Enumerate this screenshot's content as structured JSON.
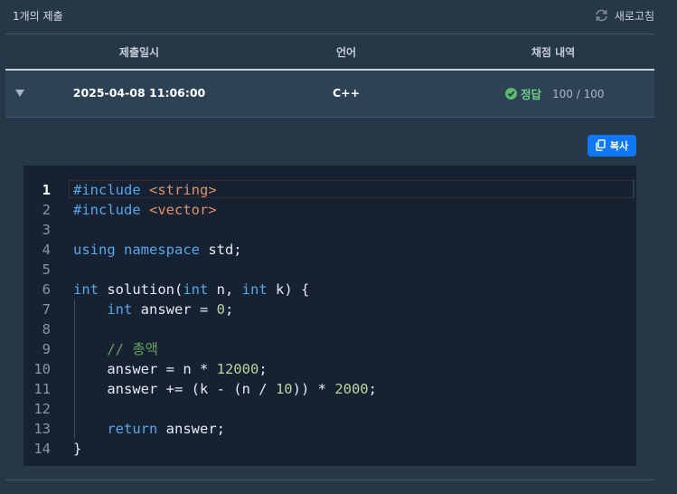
{
  "header": {
    "submission_count": "1개의 제출",
    "refresh_label": "새로고침"
  },
  "table": {
    "columns": [
      "제출일시",
      "언어",
      "채점 내역"
    ],
    "row": {
      "datetime": "2025-04-08 11:06:00",
      "language": "C++",
      "status": "정답",
      "score": "100 / 100"
    }
  },
  "copy_button": {
    "label": "복사"
  },
  "colors": {
    "background": "#263747",
    "row_background": "#2e4256",
    "editor_background": "#162131",
    "accent_blue": "#0f78f2",
    "success_green": "#6fcf83",
    "keyword": "#5aa6e8",
    "string": "#e0906a",
    "number": "#b9d6a0",
    "comment": "#6aa35f"
  },
  "editor": {
    "active_line": 1,
    "lines": [
      {
        "n": "1",
        "tokens": [
          {
            "t": "#include ",
            "c": "kw"
          },
          {
            "t": "<string>",
            "c": "str"
          }
        ]
      },
      {
        "n": "2",
        "tokens": [
          {
            "t": "#include ",
            "c": "kw"
          },
          {
            "t": "<vector>",
            "c": "str"
          }
        ]
      },
      {
        "n": "3",
        "tokens": []
      },
      {
        "n": "4",
        "tokens": [
          {
            "t": "using namespace ",
            "c": "kw"
          },
          {
            "t": "std;",
            "c": ""
          }
        ]
      },
      {
        "n": "5",
        "tokens": []
      },
      {
        "n": "6",
        "tokens": [
          {
            "t": "int",
            "c": "kw"
          },
          {
            "t": " solution(",
            "c": ""
          },
          {
            "t": "int",
            "c": "kw"
          },
          {
            "t": " n, ",
            "c": ""
          },
          {
            "t": "int",
            "c": "kw"
          },
          {
            "t": " k) {",
            "c": ""
          }
        ]
      },
      {
        "n": "7",
        "tokens": [
          {
            "t": "    ",
            "c": ""
          },
          {
            "t": "int",
            "c": "kw"
          },
          {
            "t": " answer = ",
            "c": ""
          },
          {
            "t": "0",
            "c": "num"
          },
          {
            "t": ";",
            "c": ""
          }
        ]
      },
      {
        "n": "8",
        "tokens": []
      },
      {
        "n": "9",
        "tokens": [
          {
            "t": "    ",
            "c": ""
          },
          {
            "t": "// 총액",
            "c": "com"
          }
        ]
      },
      {
        "n": "10",
        "tokens": [
          {
            "t": "    answer = n * ",
            "c": ""
          },
          {
            "t": "12000",
            "c": "num"
          },
          {
            "t": ";",
            "c": ""
          }
        ]
      },
      {
        "n": "11",
        "tokens": [
          {
            "t": "    answer += (k - (n / ",
            "c": ""
          },
          {
            "t": "10",
            "c": "num"
          },
          {
            "t": ")) * ",
            "c": ""
          },
          {
            "t": "2000",
            "c": "num"
          },
          {
            "t": ";",
            "c": ""
          }
        ]
      },
      {
        "n": "12",
        "tokens": []
      },
      {
        "n": "13",
        "tokens": [
          {
            "t": "    ",
            "c": ""
          },
          {
            "t": "return",
            "c": "kw"
          },
          {
            "t": " answer;",
            "c": ""
          }
        ]
      },
      {
        "n": "14",
        "tokens": [
          {
            "t": "}",
            "c": ""
          }
        ]
      }
    ]
  }
}
